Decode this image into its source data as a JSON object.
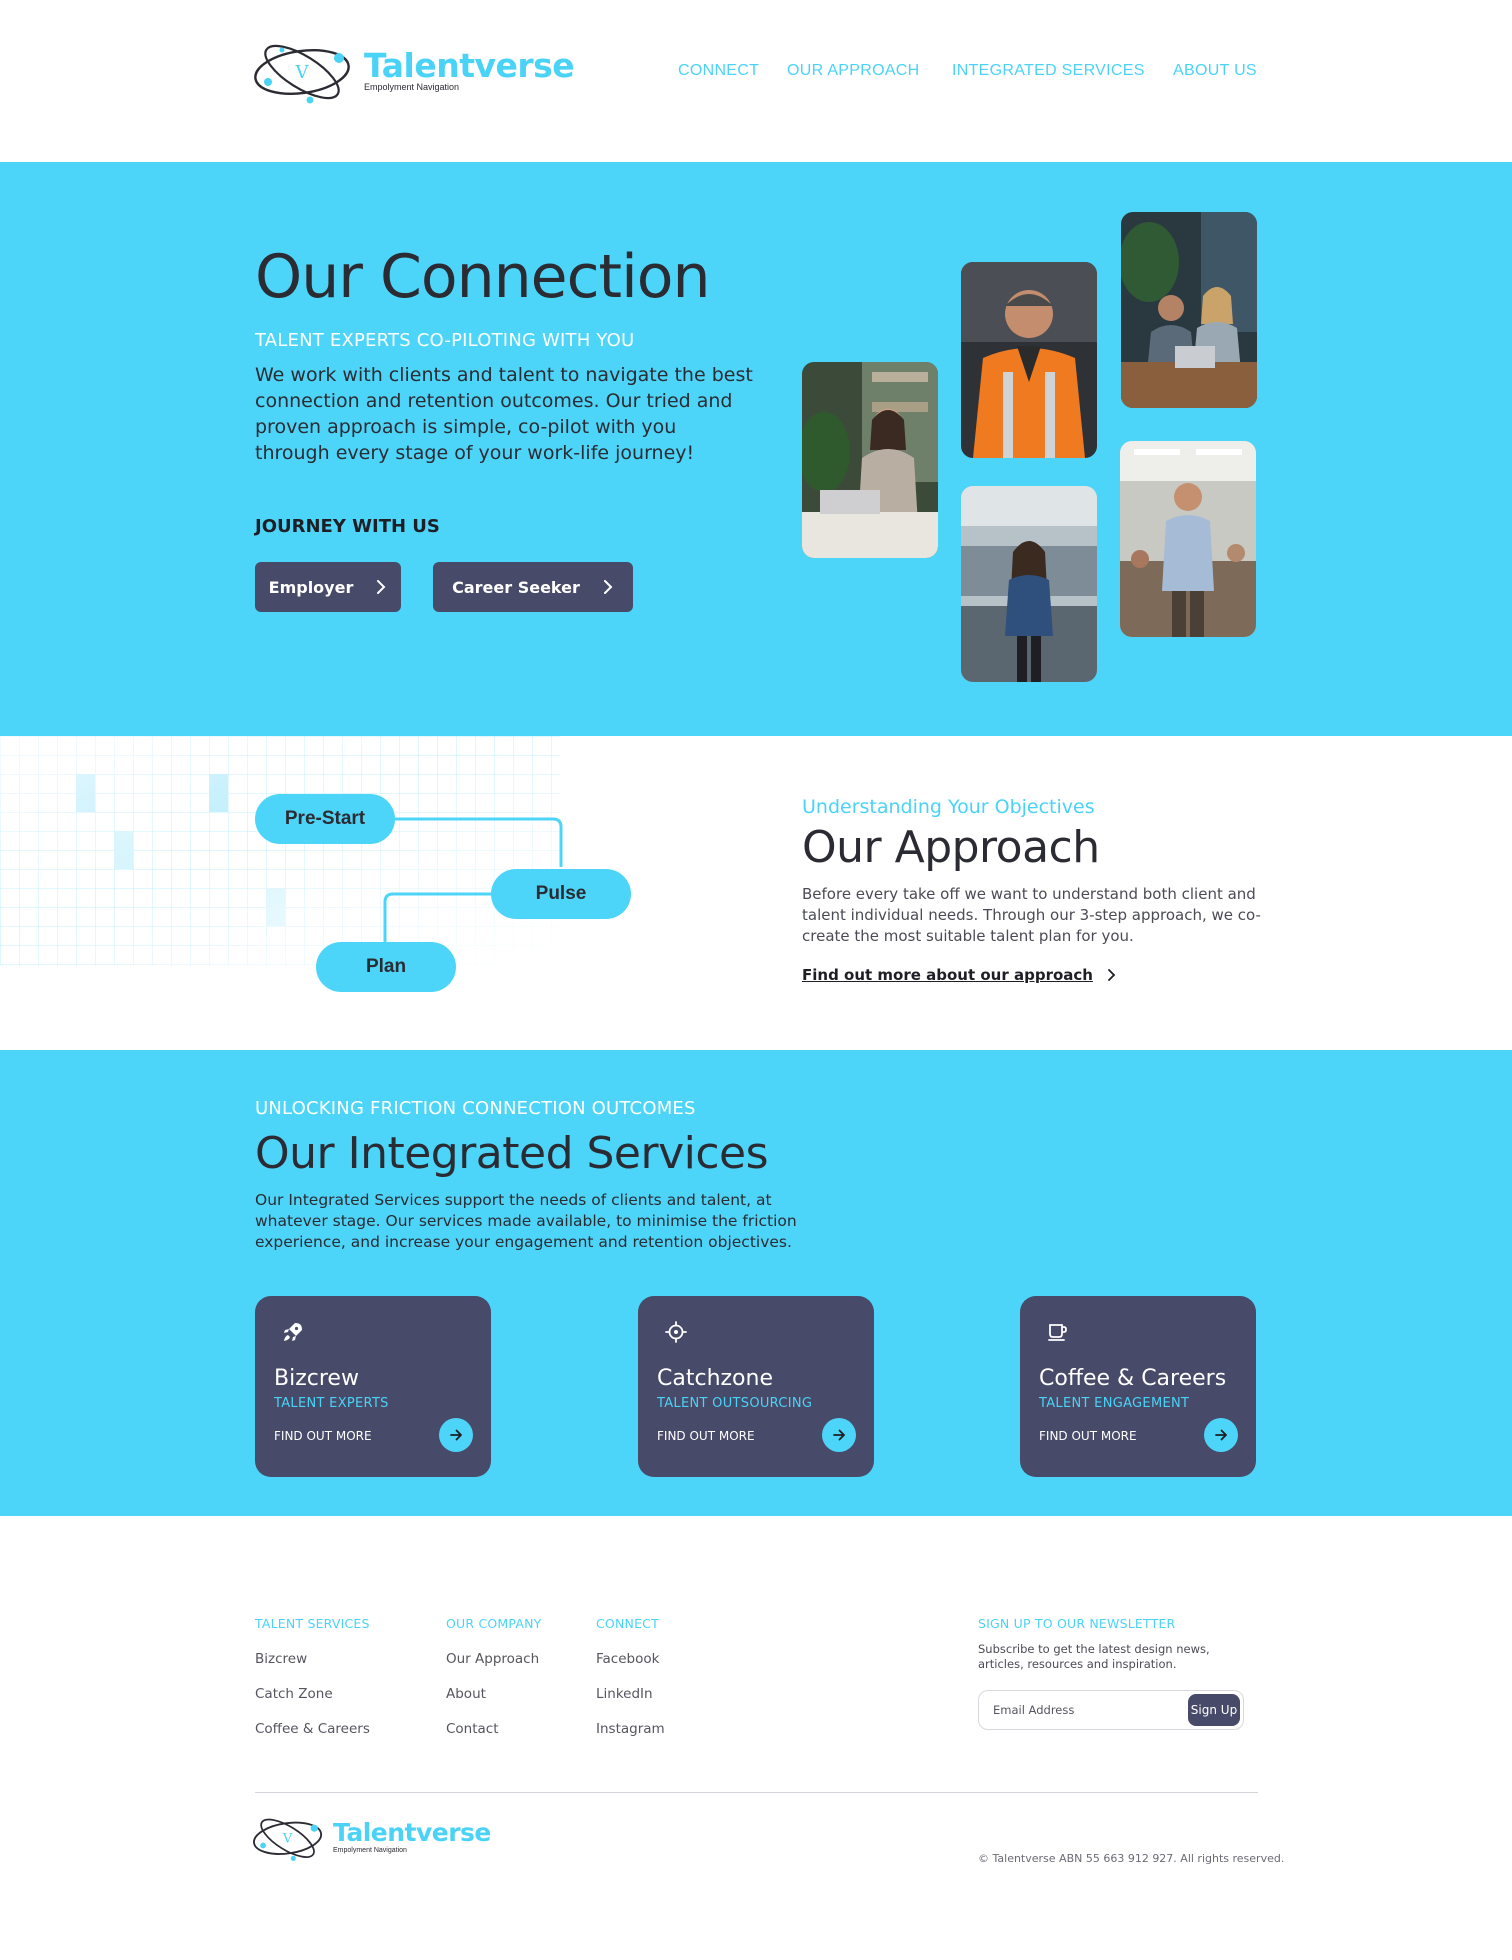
{
  "brand": {
    "name": "Talentverse",
    "tagline": "Empolyment Navigation",
    "mark_letter": "V",
    "accent": "#4ad3f7",
    "hero_bg": "#4cd5f9",
    "dark": "#474a68"
  },
  "nav": {
    "items": [
      "CONNECT",
      "OUR APPROACH",
      "INTEGRATED SERVICES",
      "ABOUT US"
    ]
  },
  "hero": {
    "title": "Our Connection",
    "subtitle": "TALENT EXPERTS CO-PILOTING WITH YOU",
    "body": "We work with clients and talent to navigate the best connection and retention outcomes. Our tried and proven approach is simple, co-pilot with you through every stage of your work-life journey!",
    "journey_label": "JOURNEY WITH US",
    "buttons": [
      {
        "label": "Employer",
        "icon": "chevron-right-icon"
      },
      {
        "label": "Career Seeker",
        "icon": "chevron-right-icon"
      }
    ],
    "photos": [
      "woman-typing-laptop-photo",
      "worker-hi-vis-vest-photo",
      "team-meeting-laptop-photo",
      "businesswoman-office-photo",
      "presenter-classroom-photo"
    ]
  },
  "approach": {
    "steps": [
      "Pre-Start",
      "Pulse",
      "Plan"
    ],
    "eyebrow": "Understanding Your Objectives",
    "title": "Our Approach",
    "body": "Before every take off we want to understand both client and talent individual needs. Through our 3-step approach, we co-create the most suitable talent plan for you.",
    "link": "Find out more about our approach"
  },
  "services": {
    "eyebrow": "UNLOCKING FRICTION CONNECTION OUTCOMES",
    "title": "Our Integrated Services",
    "body": "Our Integrated Services support the needs of clients and talent, at whatever stage. Our services made available, to minimise the friction experience, and increase your engagement and retention objectives.",
    "cards": [
      {
        "title": "Bizcrew",
        "subtitle": "TALENT EXPERTS",
        "cta": "FIND OUT MORE",
        "icon": "rocket-icon"
      },
      {
        "title": "Catchzone",
        "subtitle": "TALENT OUTSOURCING",
        "cta": "FIND OUT MORE",
        "icon": "crosshair-icon"
      },
      {
        "title": "Coffee & Careers",
        "subtitle": "TALENT ENGAGEMENT",
        "cta": "FIND OUT MORE",
        "icon": "coffee-cup-icon"
      }
    ]
  },
  "footer": {
    "columns": [
      {
        "heading": "TALENT SERVICES",
        "items": [
          "Bizcrew",
          "Catch Zone",
          "Coffee & Careers"
        ]
      },
      {
        "heading": "OUR COMPANY",
        "items": [
          "Our Approach",
          "About",
          "Contact"
        ]
      },
      {
        "heading": "CONNECT",
        "items": [
          "Facebook",
          "LinkedIn",
          "Instagram"
        ]
      }
    ],
    "newsletter": {
      "heading": "SIGN UP TO OUR NEWSLETTER",
      "description": "Subscribe to get the latest design news, articles, resources and inspiration.",
      "placeholder": "Email Address",
      "button": "Sign Up"
    },
    "copyright": "© Talentverse ABN 55 663 912 927. All rights reserved."
  }
}
